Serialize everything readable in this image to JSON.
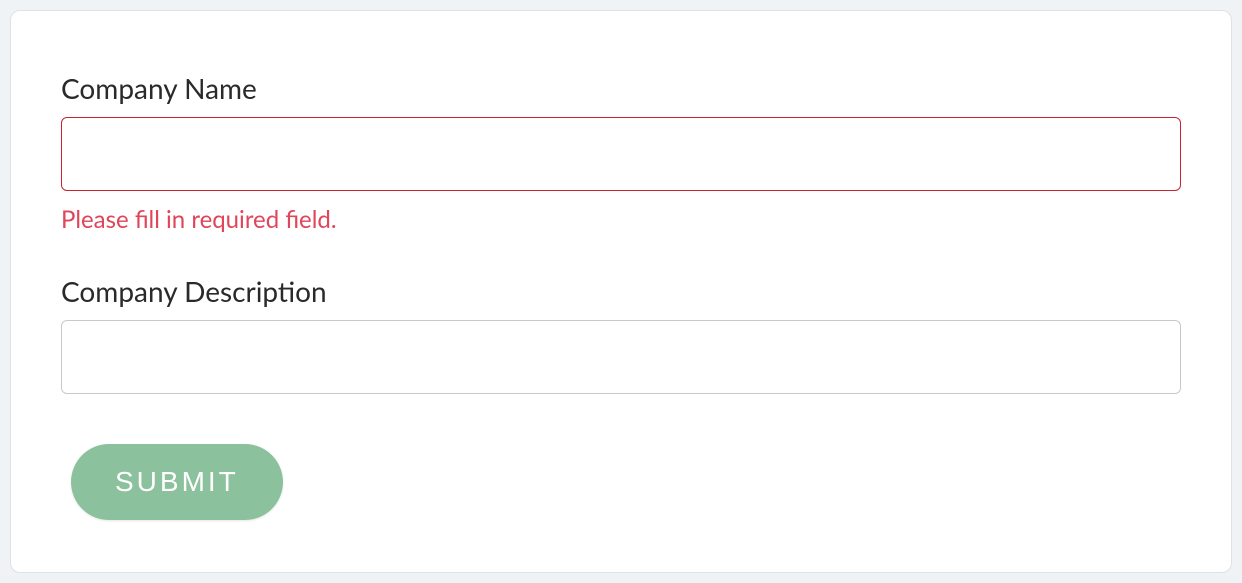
{
  "form": {
    "company_name": {
      "label": "Company Name",
      "value": "",
      "error": "Please fill in required field."
    },
    "company_description": {
      "label": "Company Description",
      "value": ""
    },
    "submit_label": "SUBMIT"
  },
  "colors": {
    "error_border": "#c82333",
    "error_text": "#e04559",
    "submit_bg": "#8bc19c",
    "page_bg": "#f0f3f5"
  }
}
